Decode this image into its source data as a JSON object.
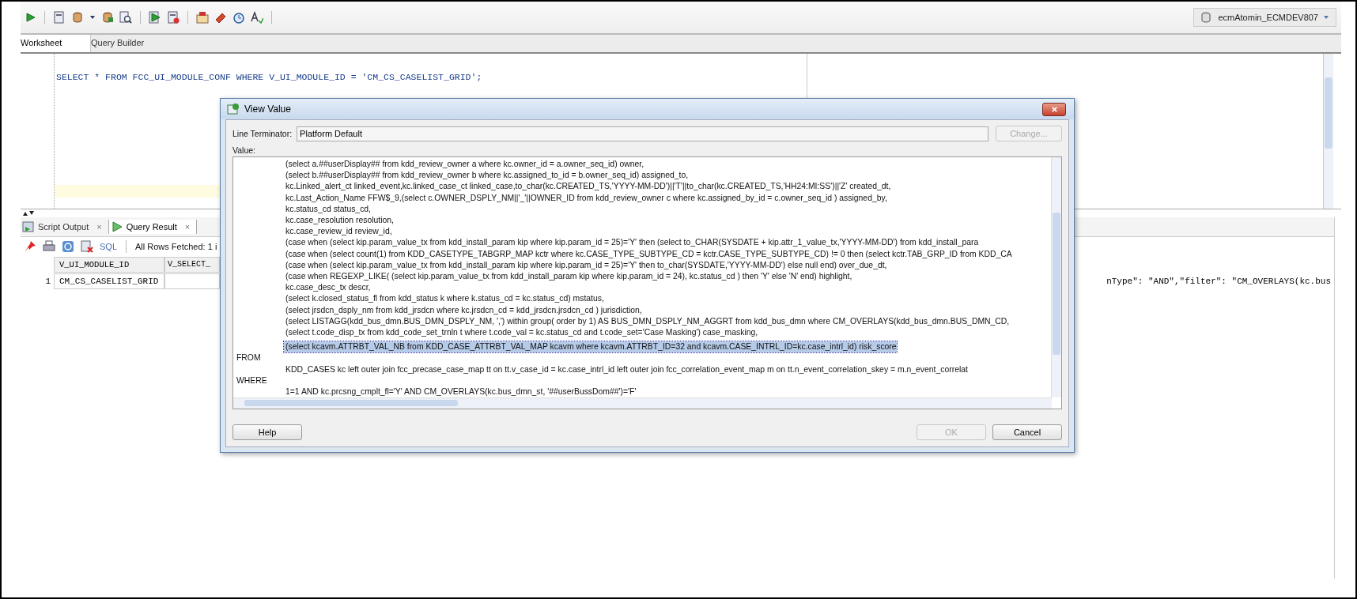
{
  "toolbar": {
    "connection": "ecmAtomin_ECMDEV807"
  },
  "editor_tabs": [
    {
      "label": "Worksheet",
      "selected": true
    },
    {
      "label": "Query Builder",
      "selected": false
    }
  ],
  "editor": {
    "sql": "SELECT * FROM FCC_UI_MODULE_CONF WHERE V_UI_MODULE_ID = 'CM_CS_CASELIST_GRID';"
  },
  "output_tabs": [
    {
      "label": "Script Output",
      "close": "×",
      "selected": false
    },
    {
      "label": "Query Result",
      "close": "×",
      "selected": true
    }
  ],
  "output_toolbar": {
    "sql_label": "SQL",
    "status": "All Rows Fetched: 1 i"
  },
  "grid": {
    "columns": [
      "V_UI_MODULE_ID",
      "V_SELECT_"
    ],
    "rows": [
      {
        "index": "1",
        "value": "CM_CS_CASELIST_GRID"
      }
    ],
    "column_3_fragment": "nType\": \"AND\",\"filter\": \"CM_OVERLAYS(kc.bus"
  },
  "dialog": {
    "title": "View Value",
    "line_terminator_label": "Line Terminator:",
    "line_terminator_value": "Platform Default",
    "change_button": {
      "label": "Change...",
      "disabled": true
    },
    "value_label": "Value:",
    "lines": [
      {
        "kind": "code",
        "text": "(select a.##userDisplay## from kdd_review_owner a where kc.owner_id = a.owner_seq_id) owner,",
        "selected": false
      },
      {
        "kind": "code",
        "text": "(select b.##userDisplay## from kdd_review_owner b where kc.assigned_to_id = b.owner_seq_id) assigned_to,",
        "selected": false
      },
      {
        "kind": "code",
        "text": "kc.Linked_alert_ct linked_event,kc.linked_case_ct linked_case,to_char(kc.CREATED_TS,'YYYY-MM-DD')||'T'||to_char(kc.CREATED_TS,'HH24:MI:SS')||'Z' created_dt,",
        "selected": false
      },
      {
        "kind": "code",
        "text": "kc.Last_Action_Name FFW$_9,(select c.OWNER_DSPLY_NM||'_'||OWNER_ID from kdd_review_owner c where kc.assigned_by_id = c.owner_seq_id ) assigned_by,",
        "selected": false
      },
      {
        "kind": "code",
        "text": "kc.status_cd status_cd,",
        "selected": false
      },
      {
        "kind": "code",
        "text": "kc.case_resolution resolution,",
        "selected": false
      },
      {
        "kind": "code",
        "text": "kc.case_review_id review_id,",
        "selected": false
      },
      {
        "kind": "code",
        "text": "(case when (select kip.param_value_tx from kdd_install_param kip where kip.param_id = 25)='Y' then (select to_CHAR(SYSDATE + kip.attr_1_value_tx,'YYYY-MM-DD') from kdd_install_para",
        "selected": false
      },
      {
        "kind": "code",
        "text": "(case when (select count(1) from KDD_CASETYPE_TABGRP_MAP kctr where kc.CASE_TYPE_SUBTYPE_CD = kctr.CASE_TYPE_SUBTYPE_CD) != 0 then (select kctr.TAB_GRP_ID from KDD_CA",
        "selected": false
      },
      {
        "kind": "code",
        "text": "(case when (select kip.param_value_tx from kdd_install_param kip where kip.param_id = 25)='Y' then to_char(SYSDATE,'YYYY-MM-DD') else null end) over_due_dt,",
        "selected": false
      },
      {
        "kind": "code",
        "text": "(case when REGEXP_LIKE( (select kip.param_value_tx from kdd_install_param kip where kip.param_id = 24), kc.status_cd ) then 'Y' else 'N' end) highlight,",
        "selected": false
      },
      {
        "kind": "code",
        "text": "kc.case_desc_tx descr,",
        "selected": false
      },
      {
        "kind": "code",
        "text": "(select k.closed_status_fl from kdd_status k where k.status_cd = kc.status_cd) mstatus,",
        "selected": false
      },
      {
        "kind": "code",
        "text": "(select jrsdcn_dsply_nm from kdd_jrsdcn where kc.jrsdcn_cd = kdd_jrsdcn.jrsdcn_cd ) jurisdiction,",
        "selected": false
      },
      {
        "kind": "code",
        "text": "(select LISTAGG(kdd_bus_dmn.BUS_DMN_DSPLY_NM, ',') within group( order by 1) AS BUS_DMN_DSPLY_NM_AGGRT from kdd_bus_dmn where CM_OVERLAYS(kdd_bus_dmn.BUS_DMN_CD,",
        "selected": false
      },
      {
        "kind": "code",
        "text": "(select t.code_disp_tx from kdd_code_set_trnln t where t.code_val = kc.status_cd and t.code_set='Case Masking') case_masking,",
        "selected": false
      },
      {
        "kind": "code",
        "text": "(select kcavm.ATTRBT_VAL_NB from KDD_CASE_ATTRBT_VAL_MAP kcavm where kcavm.ATTRBT_ID=32 and kcavm.CASE_INTRL_ID=kc.case_intrl_id) risk_score",
        "selected": true
      },
      {
        "kind": "keyword",
        "text": "FROM",
        "selected": false
      },
      {
        "kind": "code",
        "text": "KDD_CASES kc left outer join fcc_precase_case_map tt on tt.v_case_id = kc.case_intrl_id left outer join fcc_correlation_event_map m on tt.n_event_correlation_skey = m.n_event_correlat",
        "selected": false
      },
      {
        "kind": "keyword",
        "text": "WHERE",
        "selected": false
      },
      {
        "kind": "code",
        "text": "1=1 AND kc.prcsng_cmplt_fl='Y' AND CM_OVERLAYS(kc.bus_dmn_st, '##userBussDom##')='F'",
        "selected": false
      }
    ],
    "buttons": [
      {
        "label": "Help",
        "disabled": false
      },
      {
        "label": "OK",
        "disabled": true
      },
      {
        "label": "Cancel",
        "disabled": false
      }
    ]
  }
}
